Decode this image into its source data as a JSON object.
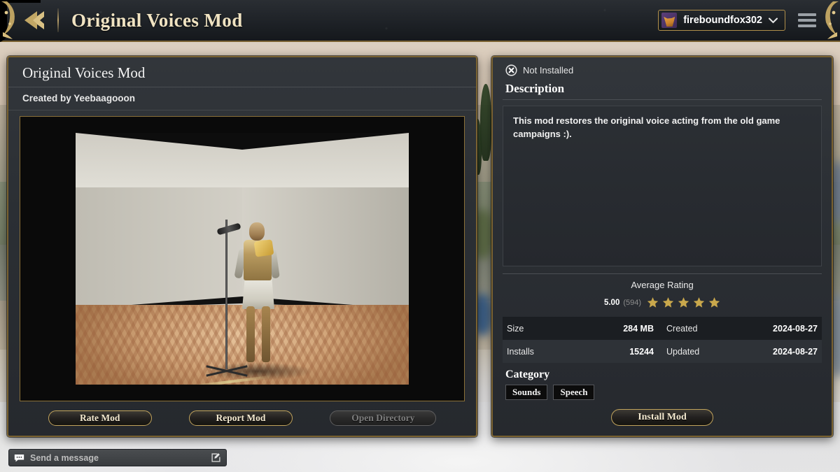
{
  "topbar": {
    "back_icon": "chevron-left-icon",
    "title": "Original Voices Mod",
    "username": "fireboundfox302",
    "dropdown_icon": "chevron-down-icon",
    "menu_icon": "hamburger-menu-icon",
    "avatar_icon": "fox-avatar"
  },
  "left_panel": {
    "mod_title": "Original Voices Mod",
    "author_line": "Created by Yeebaagooon",
    "preview_alt": "mod-preview-image",
    "buttons": [
      {
        "label": "Rate Mod",
        "name": "rate-mod-button",
        "disabled": false
      },
      {
        "label": "Report Mod",
        "name": "report-mod-button",
        "disabled": false
      },
      {
        "label": "Open Directory",
        "name": "open-directory-button",
        "disabled": true
      }
    ]
  },
  "right_panel": {
    "status": {
      "icon": "circle-x-icon",
      "text": "Not Installed"
    },
    "description_heading": "Description",
    "description_text": "This mod restores the original voice acting from the old game campaigns :).",
    "rating": {
      "label": "Average Rating",
      "score": "5.00",
      "count": "(594)",
      "stars_filled": 5,
      "stars_total": 5,
      "star_color": "#c9a84c"
    },
    "stats": [
      {
        "key": "Size",
        "value": "284 MB",
        "key2": "Created",
        "value2": "2024-08-27"
      },
      {
        "key": "Installs",
        "value": "15244",
        "key2": "Updated",
        "value2": "2024-08-27"
      }
    ],
    "category_heading": "Category",
    "categories": [
      "Sounds",
      "Speech"
    ],
    "install_button": "Install Mod"
  },
  "chat": {
    "icon": "speech-bubble-icon",
    "placeholder": "Send a message",
    "compose_icon": "compose-pencil-icon"
  },
  "colors": {
    "gold_border": "#7a6231",
    "gold_accent": "#c0a35c",
    "panel_bg": "#2b2f34",
    "title_text": "#f0e3c2"
  }
}
